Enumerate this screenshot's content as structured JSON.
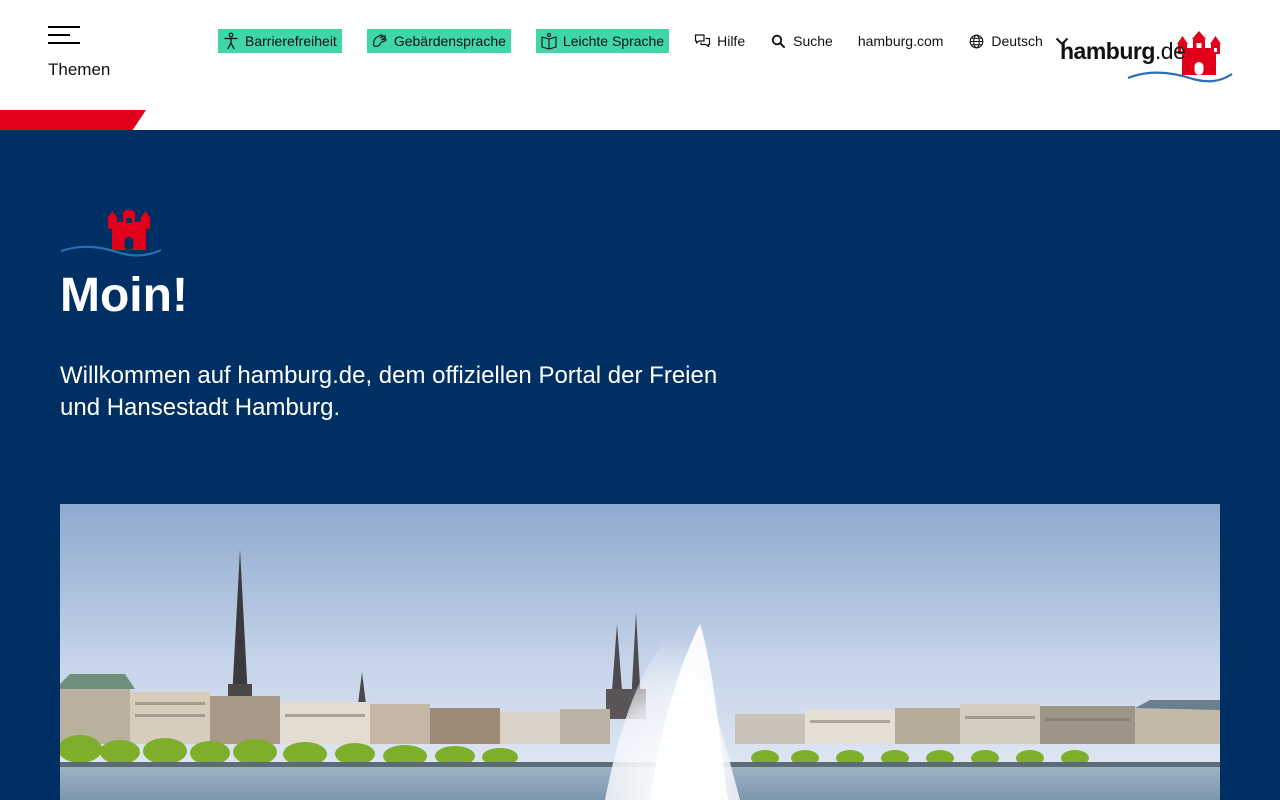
{
  "header": {
    "menu_label": "Themen",
    "nav": {
      "accessibility_label": "Barrierefreiheit",
      "sign_language_label": "Gebärdensprache",
      "easy_language_label": "Leichte Sprache",
      "help_label": "Hilfe",
      "search_label": "Suche",
      "hamburg_com_label": "hamburg.com",
      "language_label": "Deutsch"
    },
    "logo": {
      "text_main": "hamburg",
      "text_suffix": ".de"
    }
  },
  "hero": {
    "title": "Moin!",
    "subtitle": "Willkommen auf hamburg.de, dem offiziellen Portal der Freien und Hansestadt Hamburg."
  },
  "colors": {
    "accent_green": "#3fd7a8",
    "brand_red": "#e10019",
    "hero_blue": "#003063",
    "wave_blue": "#2a6eb5"
  },
  "icons": {
    "menu": "hamburger-menu-icon",
    "accessibility": "accessibility-person-icon",
    "sign_language": "sign-language-hands-icon",
    "easy_language": "easy-language-book-icon",
    "help": "help-speech-bubbles-icon",
    "search": "search-icon",
    "language": "globe-icon",
    "dropdown": "chevron-down-icon"
  }
}
